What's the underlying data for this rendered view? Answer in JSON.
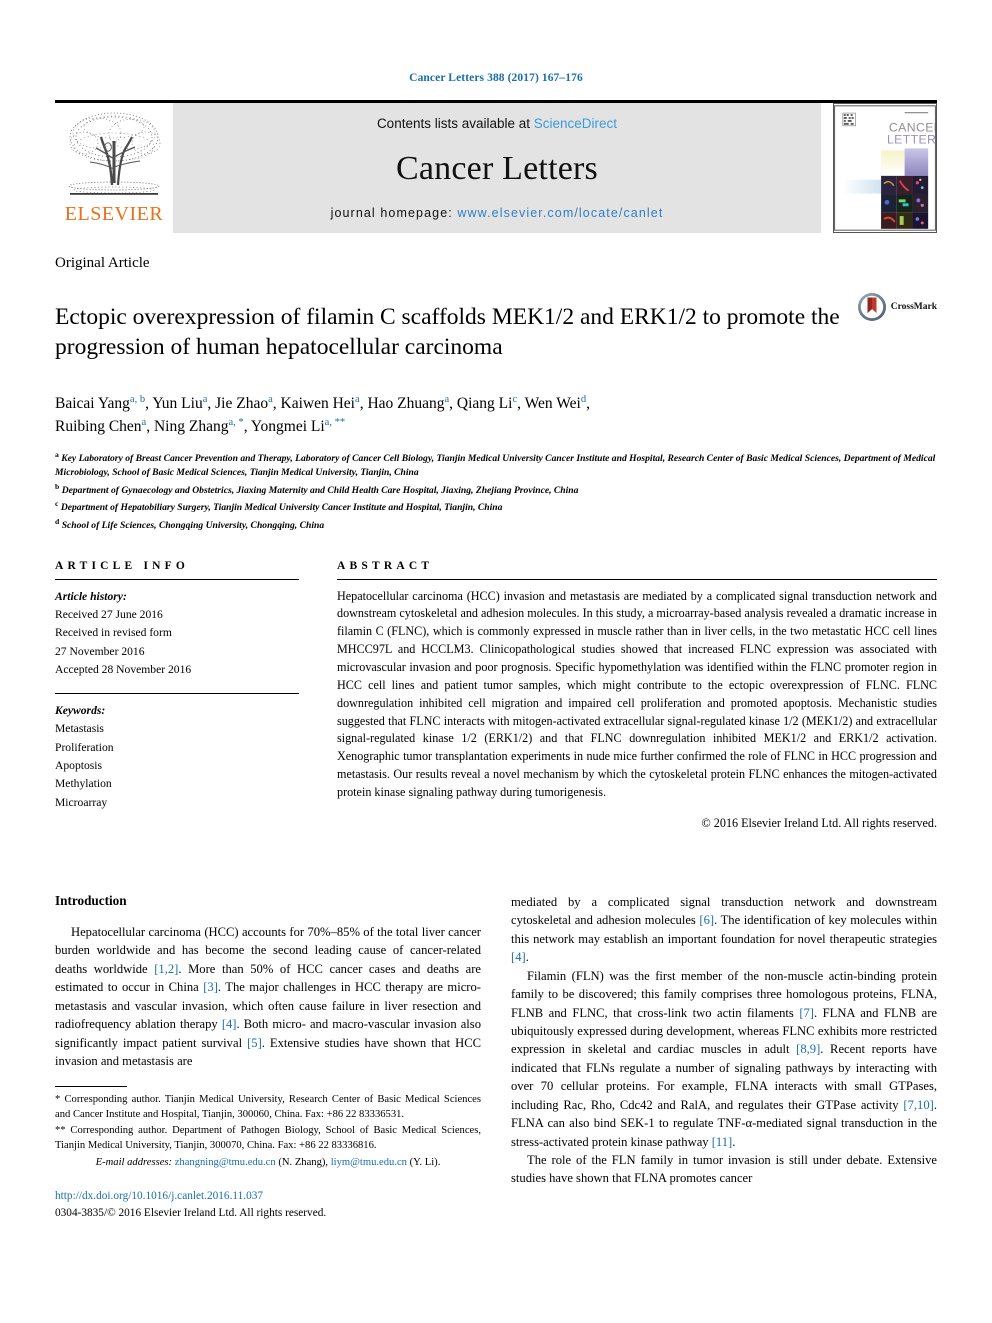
{
  "running_head": "Cancer Letters 388 (2017) 167–176",
  "masthead": {
    "contents_prefix": "Contents lists available at ",
    "sciencedirect": "ScienceDirect",
    "journal_title": "Cancer Letters",
    "homepage_prefix": "journal homepage: ",
    "homepage_url": "www.elsevier.com/locate/canlet",
    "publisher_name": "ELSEVIER",
    "publisher_logo_icon": "elsevier-tree-icon",
    "cover_title_line1": "CANCER",
    "cover_title_line2": "LETTERS",
    "link_color": "#3a9cd9",
    "brand_color": "#E9711C"
  },
  "article_type": "Original Article",
  "title": "Ectopic overexpression of filamin C scaffolds MEK1/2 and ERK1/2 to promote the progression of human hepatocellular carcinoma",
  "crossmark": {
    "label": "CrossMark",
    "icon": "crossmark-icon"
  },
  "authors_line1": [
    {
      "name": "Baicai Yang",
      "sup": "a, b"
    },
    {
      "name": "Yun Liu",
      "sup": "a"
    },
    {
      "name": "Jie Zhao",
      "sup": "a"
    },
    {
      "name": "Kaiwen Hei",
      "sup": "a"
    },
    {
      "name": "Hao Zhuang",
      "sup": "a"
    },
    {
      "name": "Qiang Li",
      "sup": "c"
    },
    {
      "name": "Wen Wei",
      "sup": "d"
    }
  ],
  "authors_line2": [
    {
      "name": "Ruibing Chen",
      "sup": "a"
    },
    {
      "name": "Ning Zhang",
      "sup": "a, *"
    },
    {
      "name": "Yongmei Li",
      "sup": "a, **"
    }
  ],
  "affiliations": [
    {
      "label": "a",
      "text": "Key Laboratory of Breast Cancer Prevention and Therapy, Laboratory of Cancer Cell Biology, Tianjin Medical University Cancer Institute and Hospital, Research Center of Basic Medical Sciences, Department of Medical Microbiology, School of Basic Medical Sciences, Tianjin Medical University, Tianjin, China"
    },
    {
      "label": "b",
      "text": "Department of Gynaecology and Obstetrics, Jiaxing Maternity and Child Health Care Hospital, Jiaxing, Zhejiang Province, China"
    },
    {
      "label": "c",
      "text": "Department of Hepatobiliary Surgery, Tianjin Medical University Cancer Institute and Hospital, Tianjin, China"
    },
    {
      "label": "d",
      "text": "School of Life Sciences, Chongqing University, Chongqing, China"
    }
  ],
  "article_info": {
    "heading": "ARTICLE INFO",
    "history_label": "Article history:",
    "history": [
      "Received 27 June 2016",
      "Received in revised form",
      "27 November 2016",
      "Accepted 28 November 2016"
    ],
    "keywords_label": "Keywords:",
    "keywords": [
      "Metastasis",
      "Proliferation",
      "Apoptosis",
      "Methylation",
      "Microarray"
    ]
  },
  "abstract": {
    "heading": "ABSTRACT",
    "text": "Hepatocellular carcinoma (HCC) invasion and metastasis are mediated by a complicated signal transduction network and downstream cytoskeletal and adhesion molecules. In this study, a microarray-based analysis revealed a dramatic increase in filamin C (FLNC), which is commonly expressed in muscle rather than in liver cells, in the two metastatic HCC cell lines MHCC97L and HCCLM3. Clinicopathological studies showed that increased FLNC expression was associated with microvascular invasion and poor prognosis. Specific hypomethylation was identified within the FLNC promoter region in HCC cell lines and patient tumor samples, which might contribute to the ectopic overexpression of FLNC. FLNC downregulation inhibited cell migration and impaired cell proliferation and promoted apoptosis. Mechanistic studies suggested that FLNC interacts with mitogen-activated extracellular signal-regulated kinase 1/2 (MEK1/2) and extracellular signal-regulated kinase 1/2 (ERK1/2) and that FLNC downregulation inhibited MEK1/2 and ERK1/2 activation. Xenographic tumor transplantation experiments in nude mice further confirmed the role of FLNC in HCC progression and metastasis. Our results reveal a novel mechanism by which the cytoskeletal protein FLNC enhances the mitogen-activated protein kinase signaling pathway during tumorigenesis.",
    "copyright": "© 2016 Elsevier Ireland Ltd. All rights reserved."
  },
  "introduction": {
    "heading": "Introduction",
    "left_paragraph": "Hepatocellular carcinoma (HCC) accounts for 70%–85% of the total liver cancer burden worldwide and has become the second leading cause of cancer-related deaths worldwide [1,2]. More than 50% of HCC cancer cases and deaths are estimated to occur in China [3]. The major challenges in HCC therapy are micro-metastasis and vascular invasion, which often cause failure in liver resection and radiofrequency ablation therapy [4]. Both micro- and macro-vascular invasion also significantly impact patient survival [5]. Extensive studies have shown that HCC invasion and metastasis are",
    "right_paragraph_1": "mediated by a complicated signal transduction network and downstream cytoskeletal and adhesion molecules [6]. The identification of key molecules within this network may establish an important foundation for novel therapeutic strategies [4].",
    "right_paragraph_2": "Filamin (FLN) was the first member of the non-muscle actin-binding protein family to be discovered; this family comprises three homologous proteins, FLNA, FLNB and FLNC, that cross-link two actin filaments [7]. FLNA and FLNB are ubiquitously expressed during development, whereas FLNC exhibits more restricted expression in skeletal and cardiac muscles in adult [8,9]. Recent reports have indicated that FLNs regulate a number of signaling pathways by interacting with over 70 cellular proteins. For example, FLNA interacts with small GTPases, including Rac, Rho, Cdc42 and RalA, and regulates their GTPase activity [7,10]. FLNA can also bind SEK-1 to regulate TNF-α-mediated signal transduction in the stress-activated protein kinase pathway [11].",
    "right_paragraph_3": "The role of the FLN family in tumor invasion is still under debate. Extensive studies have shown that FLNA promotes cancer"
  },
  "footnotes": {
    "corresponding_1": "* Corresponding author. Tianjin Medical University, Research Center of Basic Medical Sciences and Cancer Institute and Hospital, Tianjin, 300060, China. Fax: +86 22 83336531.",
    "corresponding_2": "** Corresponding author. Department of Pathogen Biology, School of Basic Medical Sciences, Tianjin Medical University, Tianjin, 300070, China. Fax: +86 22 83336816.",
    "email_label": "E-mail addresses:",
    "email_1": "zhangning@tmu.edu.cn",
    "email_1_owner": "(N. Zhang),",
    "email_2": "liym@tmu.edu.cn",
    "email_2_owner": "(Y. Li).",
    "doi": "http://dx.doi.org/10.1016/j.canlet.2016.11.037",
    "issn_line": "0304-3835/© 2016 Elsevier Ireland Ltd. All rights reserved."
  }
}
